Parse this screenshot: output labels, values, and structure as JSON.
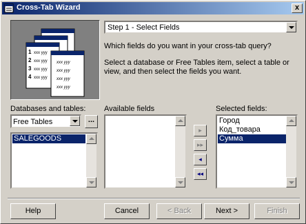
{
  "window": {
    "title": "Cross-Tab Wizard",
    "close_symbol": "x"
  },
  "illustration": {
    "rows": [
      {
        "num": "1",
        "text": "xxx  yyy"
      },
      {
        "num": "2",
        "text": "xxx  yyy"
      },
      {
        "num": "3",
        "text": "xxx  yyy"
      },
      {
        "num": "4",
        "text": "xxx  yyy"
      }
    ]
  },
  "step_dropdown": {
    "value": "Step 1 - Select Fields"
  },
  "question": "Which fields do you want in your cross-tab query?",
  "instructions": "Select a database or Free Tables item, select a table or view, and then select the fields you want.",
  "databases": {
    "label": "Databases and tables:",
    "combo_value": "Free Tables",
    "browse_label": "...",
    "tables": [
      "SALEGOODS"
    ],
    "selected_table": "SALEGOODS"
  },
  "available_fields": {
    "label": "Available fields",
    "items": []
  },
  "move_buttons": {
    "add": "▸",
    "add_all": "▸▸",
    "remove": "◂",
    "remove_all": "◂◂"
  },
  "selected_fields": {
    "label": "Selected fields:",
    "items": [
      "Город",
      "Код_товара",
      "Сумма"
    ],
    "selected": "Сумма"
  },
  "buttons": {
    "help": "Help",
    "cancel": "Cancel",
    "back": "< Back",
    "next": "Next >",
    "finish": "Finish"
  },
  "colors": {
    "titlebar_start": "#0a246a",
    "titlebar_end": "#a6caf0",
    "selection": "#0a246a",
    "face": "#d4d0c8"
  }
}
